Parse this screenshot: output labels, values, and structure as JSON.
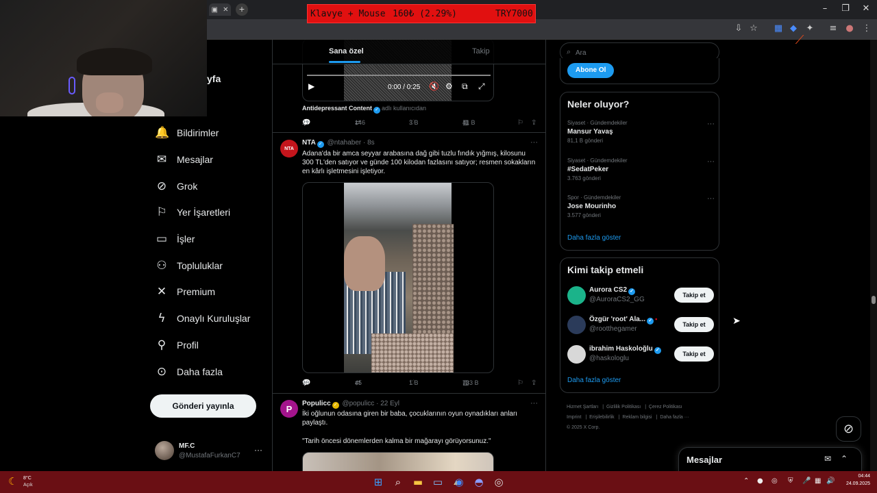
{
  "overlay": {
    "left": "Klavye + Mouse",
    "middle": "160₺ (2.29%)",
    "right": "TRY7000"
  },
  "brand_fragment": "yfa",
  "nav": [
    {
      "label": "Bildirimler",
      "icon": "bell-icon",
      "glyph": "🔔"
    },
    {
      "label": "Mesajlar",
      "icon": "envelope-icon",
      "glyph": "✉"
    },
    {
      "label": "Grok",
      "icon": "grok-icon",
      "glyph": "⊘"
    },
    {
      "label": "Yer İşaretleri",
      "icon": "bookmark-icon",
      "glyph": "⚐"
    },
    {
      "label": "İşler",
      "icon": "briefcase-icon",
      "glyph": "▭"
    },
    {
      "label": "Topluluklar",
      "icon": "communities-icon",
      "glyph": "⚇"
    },
    {
      "label": "Premium",
      "icon": "x-logo-icon",
      "glyph": "✕"
    },
    {
      "label": "Onaylı Kuruluşlar",
      "icon": "lightning-icon",
      "glyph": "ϟ"
    },
    {
      "label": "Profil",
      "icon": "person-icon",
      "glyph": "⚲"
    },
    {
      "label": "Daha fazla",
      "icon": "more-circle-icon",
      "glyph": "⊙"
    }
  ],
  "post_button": "Gönderi yayınla",
  "profile": {
    "name": "MF.C",
    "handle": "@MustafaFurkanC7",
    "more": "···"
  },
  "feed_tabs": {
    "for_you": "Sana özel",
    "following": "Takip"
  },
  "posts": [
    {
      "video_time": "0:00 / 0:25",
      "source_name": "Antidepressant Content",
      "source_suffix": "adlı kullanıcıdan",
      "replies": "21",
      "reposts": "146",
      "likes": "3 B",
      "views": "41 B"
    },
    {
      "avatar_text": "NTA",
      "name": "NTA",
      "handle": "@ntahaber",
      "time": "· 8s",
      "text": "Adana'da bir amca seyyar arabasına dağ gibi tuzlu fındık yığmış, kilosunu 300 TL'den satıyor ve günde 100 kilodan fazlasını satıyor; resmen sokakların en kârlı işletmesini işletiyor.",
      "replies": "96",
      "reposts": "45",
      "likes": "1 B",
      "views": "733 B"
    },
    {
      "avatar_text": "P",
      "name": "Populicc",
      "handle": "@populicc",
      "time": "· 22 Eyl",
      "text": "İki oğlunun odasına giren bir baba, çocuklarının oyun oynadıkları anları paylaştı.",
      "text2": "\"Tarih öncesi dönemlerden kalma bir mağarayı görüyorsunuz.\""
    }
  ],
  "search": {
    "placeholder": "Ara"
  },
  "subscribe_button": "Abone Ol",
  "trends": {
    "title": "Neler oluyor?",
    "items": [
      {
        "category": "Siyaset · Gündemdekiler",
        "topic": "Mansur Yavaş",
        "count": "81,1 B gönderi"
      },
      {
        "category": "Siyaset · Gündemdekiler",
        "topic": "#SedatPeker",
        "count": "3.763 gönderi"
      },
      {
        "category": "Spor · Gündemdekiler",
        "topic": "Jose Mourinho",
        "count": "3.577 gönderi"
      }
    ],
    "show_more": "Daha fazla göster"
  },
  "who_to_follow": {
    "title": "Kimi takip etmeli",
    "items": [
      {
        "name": "Aurora CS2",
        "handle": "@AuroraCS2_GG",
        "button": "Takip et",
        "color": "#1bb38a"
      },
      {
        "name": "Özgür 'root' Ala...",
        "handle": "@rootthegamer",
        "button": "Takip et",
        "color": "#2b3b5a"
      },
      {
        "name": "ibrahim Haskoloğlu",
        "handle": "@haskologlu",
        "button": "Takip et",
        "color": "#d8d8d8"
      }
    ],
    "show_more": "Daha fazla göster"
  },
  "footer": [
    "Hizmet Şartları",
    "Gizlilik Politikası",
    "Çerez Politikası",
    "Imprint",
    "Erişilebilirlik",
    "Reklam bilgisi",
    "Daha fazla ···",
    "© 2025 X Corp."
  ],
  "messages_drawer": {
    "title": "Mesajlar"
  },
  "taskbar": {
    "temp": "8°C",
    "condition": "Açık",
    "time": "04:44",
    "date": "24.09.2025"
  },
  "colors": {
    "accent": "#1d9bf0",
    "taskbar": "#6a0f14",
    "overlay": "#e11010"
  }
}
